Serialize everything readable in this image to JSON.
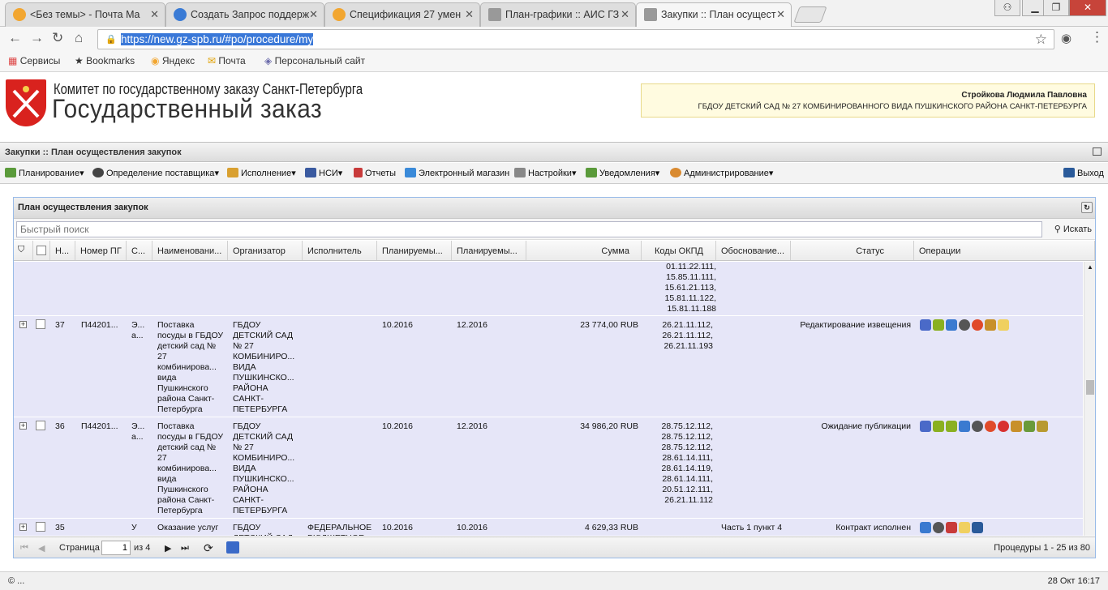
{
  "browser": {
    "tabs": [
      {
        "title": "<Без темы> - Почта Ma",
        "color": "#f2a630"
      },
      {
        "title": "Создать Запрос поддерж",
        "color": "#3a7bd5"
      },
      {
        "title": "Спецификация 27 умен",
        "color": "#f2a630"
      },
      {
        "title": "План-графики :: АИС ГЗ",
        "color": "#888888"
      },
      {
        "title": "Закупки :: План осущест",
        "color": "#888888"
      }
    ],
    "url": "https://new.gz-spb.ru/#po/procedure/my",
    "bookmarks": [
      "Сервисы",
      "Bookmarks",
      "Яндекс",
      "Почта",
      "Персональный сайт"
    ]
  },
  "header": {
    "line1": "Комитет по государственному заказу Санкт-Петербурга",
    "line2": "Государственный заказ",
    "user_name": "Стройкова Людмила Павловна",
    "user_org": "ГБДОУ ДЕТСКИЙ САД № 27 КОМБИНИРОВАННОГО ВИДА ПУШКИНСКОГО РАЙОНА САНКТ-ПЕТЕРБУРГА"
  },
  "module": {
    "title": "Закупки :: План осуществления закупок"
  },
  "menu": [
    "Планирование",
    "Определение поставщика",
    "Исполнение",
    "НСИ",
    "Отчеты",
    "Электронный магазин",
    "Настройки",
    "Уведомления",
    "Администрирование"
  ],
  "menu_exit": "Выход",
  "panel": {
    "title": "План осуществления закупок",
    "search_placeholder": "Быстрый поиск",
    "search_button": "Искать",
    "columns": [
      "Н...",
      "Номер ПГ",
      "С...",
      "Наименовани...",
      "Организатор",
      "Исполнитель",
      "Планируемы...",
      "Планируемы...",
      "Сумма",
      "Коды ОКПД",
      "Обоснование...",
      "Статус",
      "Операции"
    ]
  },
  "rows": [
    {
      "n": "",
      "num": "",
      "s": "",
      "name": "",
      "org": "",
      "exec": "",
      "p1": "",
      "p2": "",
      "sum": "",
      "okpd": "01.11.22.111,\n15.85.11.111,\n15.61.21.113,\n15.81.11.122,\n15.81.11.188",
      "basis": "",
      "status": ""
    },
    {
      "n": "37",
      "num": "П44201...",
      "s": "Э...\nа...",
      "name": "Поставка посуды в ГБДОУ детский сад № 27 комбинирова... вида Пушкинского района Санкт-Петербурга",
      "org": "ГБДОУ ДЕТСКИЙ САД № 27 КОМБИНИРО... ВИДА ПУШКИНСКО... РАЙОНА САНКТ-ПЕТЕРБУРГА",
      "exec": "",
      "p1": "10.2016",
      "p2": "12.2016",
      "sum": "23 774,00 RUB",
      "okpd": "26.21.11.112,\n26.21.11.112,\n26.21.11.193",
      "basis": "",
      "status": "Редактирование извещения"
    },
    {
      "n": "36",
      "num": "П44201...",
      "s": "Э...\nа...",
      "name": "Поставка посуды в ГБДОУ детский сад № 27 комбинирова... вида Пушкинского района Санкт-Петербурга",
      "org": "ГБДОУ ДЕТСКИЙ САД № 27 КОМБИНИРО... ВИДА ПУШКИНСКО... РАЙОНА САНКТ-ПЕТЕРБУРГА",
      "exec": "",
      "p1": "10.2016",
      "p2": "12.2016",
      "sum": "34 986,20 RUB",
      "okpd": "28.75.12.112,\n28.75.12.112,\n28.75.12.112,\n28.61.14.111,\n28.61.14.119,\n28.61.14.111,\n20.51.12.111,\n26.21.11.112",
      "basis": "",
      "status": "Ожидание публикации"
    },
    {
      "n": "35",
      "num": "",
      "s": "У",
      "name": "Оказание услуг",
      "org": "ГБДОУ ДЕТСКИЙ САД",
      "exec": "ФЕДЕРАЛЬНОЕ БЮДЖЕТНОЕ",
      "p1": "10.2016",
      "p2": "10.2016",
      "sum": "4 629,33 RUB",
      "okpd": "",
      "basis": "Часть 1 пункт 4",
      "status": "Контракт исполнен"
    }
  ],
  "pager": {
    "page_label": "Страница",
    "page": "1",
    "of": "из 4",
    "summary": "Процедуры 1 - 25 из 80"
  },
  "footer": {
    "left": "© ...",
    "right": "28 Окт 16:17"
  }
}
